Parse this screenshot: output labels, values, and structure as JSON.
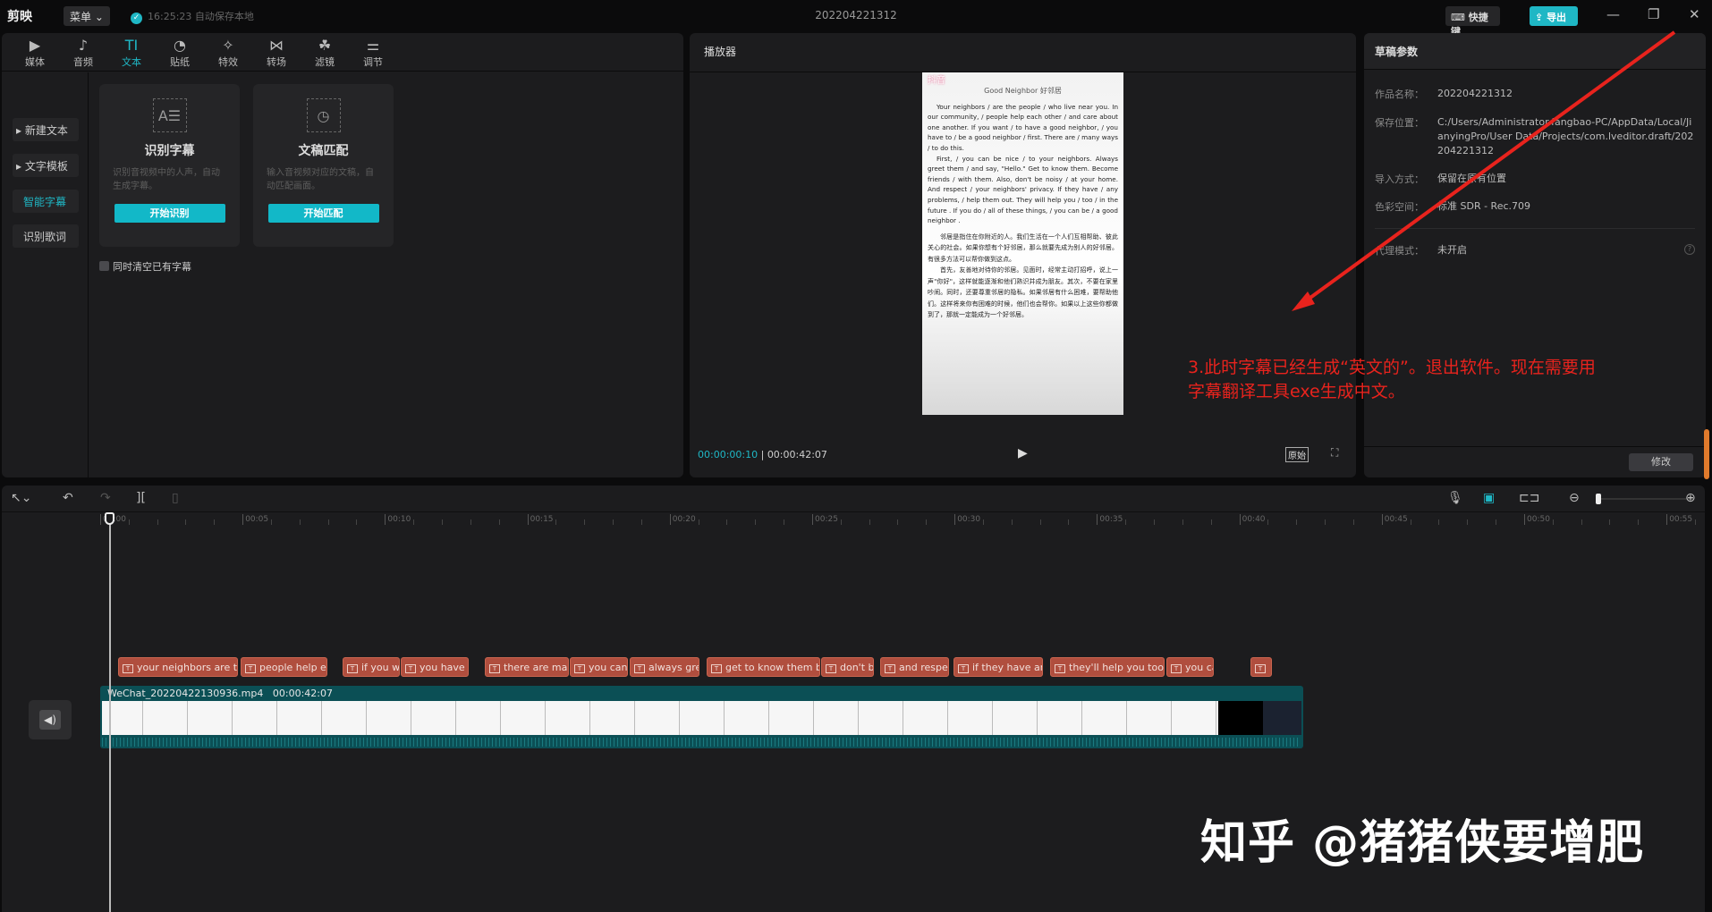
{
  "app": {
    "logo": "剪映",
    "menu": "菜单",
    "autosave_time": "16:25:23",
    "autosave_text": "自动保存本地",
    "title": "202204221312",
    "hotkey": "快捷键",
    "export": "导出"
  },
  "tabs": [
    {
      "icon": "▶",
      "label": "媒体"
    },
    {
      "icon": "♪",
      "label": "音频"
    },
    {
      "icon": "TI",
      "label": "文本"
    },
    {
      "icon": "◔",
      "label": "贴纸"
    },
    {
      "icon": "✧",
      "label": "特效"
    },
    {
      "icon": "⋈",
      "label": "转场"
    },
    {
      "icon": "☘",
      "label": "滤镜"
    },
    {
      "icon": "⚌",
      "label": "调节"
    }
  ],
  "side": [
    "▸ 新建文本",
    "▸ 文字模板",
    "智能字幕",
    "识别歌词"
  ],
  "cards": [
    {
      "title": "识别字幕",
      "desc": "识别音视频中的人声，自动生成字幕。",
      "button": "开始识别"
    },
    {
      "title": "文稿匹配",
      "desc": "输入音视频对应的文稿，自动匹配画面。",
      "button": "开始匹配"
    }
  ],
  "clear_checkbox": "同时清空已有字幕",
  "player": {
    "title": "播放器",
    "current": "00:00:00:10",
    "total": "00:00:42:07",
    "original": "原始",
    "preview": {
      "app": "抖音",
      "heading": "Good Neighbor  好邻居",
      "en1": "Your neighbors / are the people / who live near you. In our community, / people help each other / and care about one another. If you want / to have a good neighbor, / you have to / be a good neighbor / first. There are / many ways / to do this.",
      "en2": "First, / you can be nice / to your neighbors. Always greet them / and say, \"Hello.\" Get to know them. Become friends / with them. Also, don't be noisy / at your home. And respect / your neighbors' privacy. If they have / any problems, / help them out. They will help you / too / in the future . If you do / all of these things, / you can be / a good neighbor .",
      "cn1": "邻居是指住在你附近的人。我们生活在一个人们互相帮助、彼此关心的社会。如果你想有个好邻居，那么就要先成为别人的好邻居。有很多方法可以帮你做到这点。",
      "cn2": "首先，友善地对待你的邻居。见面时，经常主动打招呼，说上一声\"你好\"，这样就能逐渐和他们熟识并成为朋友。其次，不要在家里吵闹。同时，还要尊重邻居的隐私。如果邻居有什么困难，要帮助他们。这样将来你有困难的时候，他们也会帮你。如果以上这些你都做到了，那就一定能成为一个好邻居。"
    }
  },
  "draft": {
    "title": "草稿参数",
    "rows": [
      {
        "k": "作品名称：",
        "v": "202204221312"
      },
      {
        "k": "保存位置：",
        "v": "C:/Users/Administrator.fangbao-PC/AppData/Local/JianyingPro/User Data/Projects/com.lveditor.draft/202204221312"
      },
      {
        "k": "导入方式：",
        "v": "保留在原有位置"
      },
      {
        "k": "色彩空间：",
        "v": "标准 SDR - Rec.709"
      },
      {
        "k": "代理模式：",
        "v": "未开启"
      }
    ],
    "modify": "修改"
  },
  "ruler": [
    "00:00",
    "00:05",
    "00:10",
    "00:15",
    "00:20",
    "00:25",
    "00:30",
    "00:35",
    "00:40",
    "00:45",
    "00:50",
    "00:55"
  ],
  "subtitles": [
    "your neighbors are the",
    "people help eac",
    "if you wa",
    "you have to",
    "there are many",
    "you can",
    "always gre",
    "get to know them bec",
    "don't b",
    "and respec",
    "if they have any",
    "they'll help you too in",
    "you ca",
    ""
  ],
  "video": {
    "name": "WeChat_20220422130936.mp4",
    "duration": "00:00:42:07"
  },
  "annotation": {
    "line1": "3.此时字幕已经生成“英文的”。退出软件。现在需要用",
    "line2": "字幕翻译工具exe生成中文。",
    "color": "#e8231d"
  },
  "watermark": "知乎 @猪猪侠要增肥"
}
